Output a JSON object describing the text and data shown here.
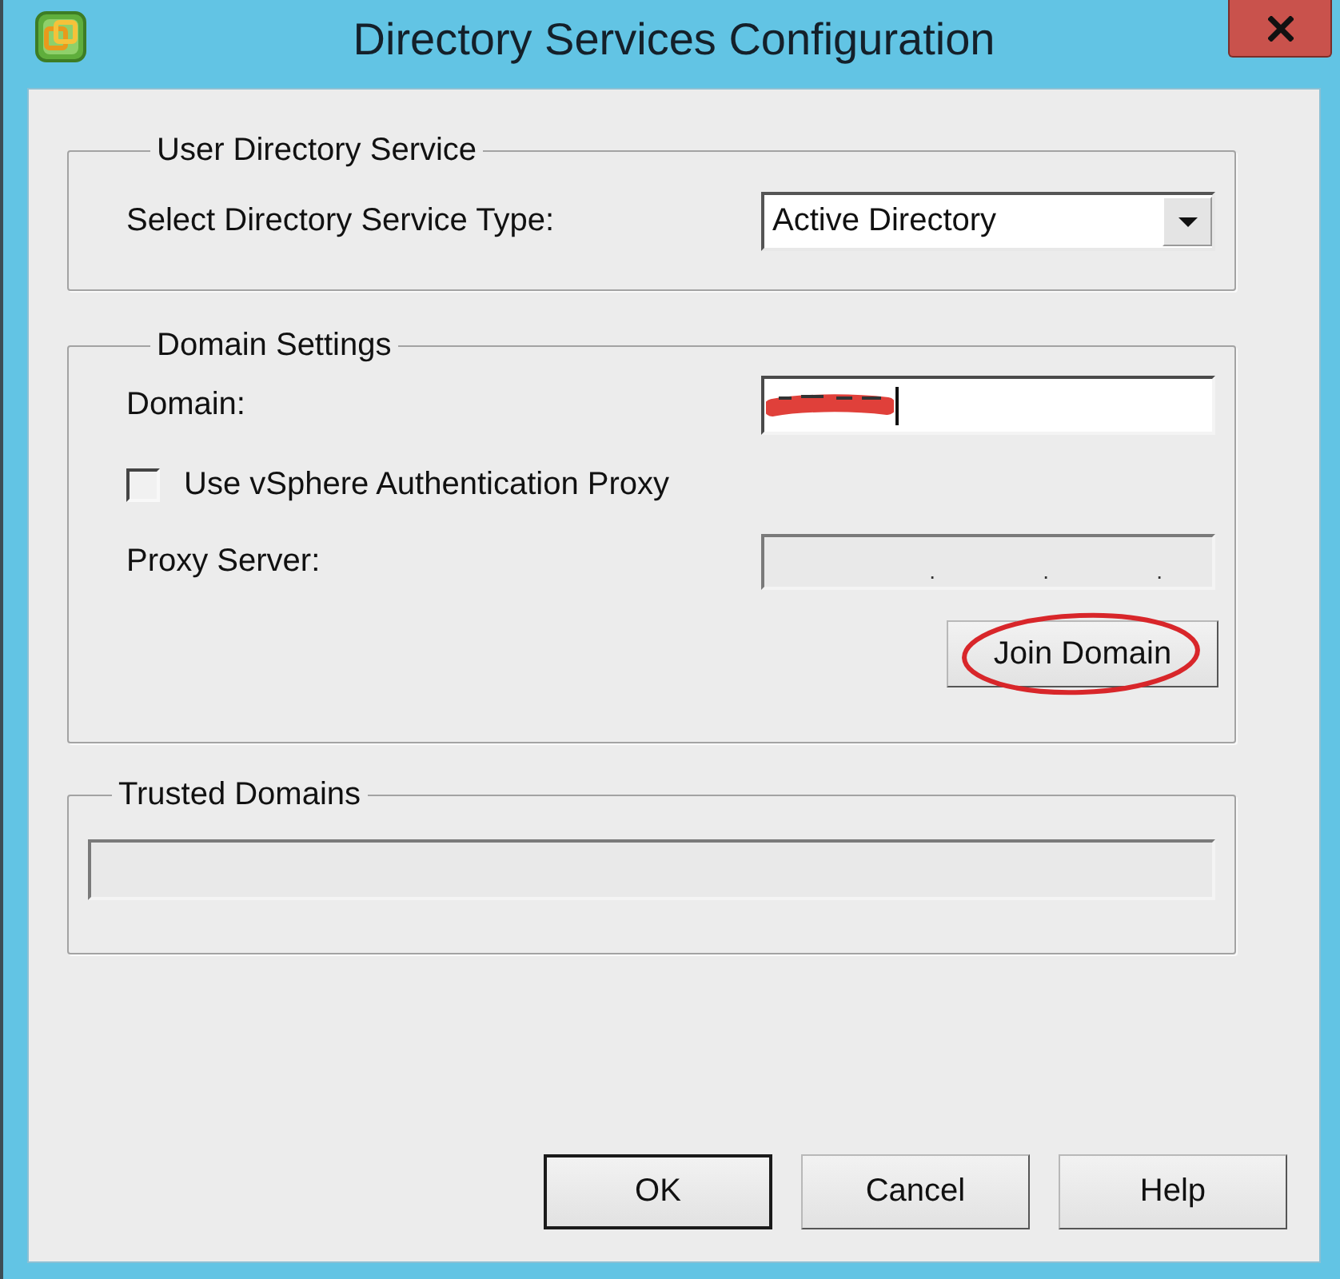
{
  "window": {
    "title": "Directory Services Configuration"
  },
  "user_directory_service": {
    "legend": "User Directory Service",
    "service_type": {
      "label": "Select Directory Service Type:",
      "value": "Active Directory"
    }
  },
  "domain_settings": {
    "legend": "Domain Settings",
    "domain": {
      "label": "Domain:",
      "redacted": true,
      "focused": true
    },
    "use_proxy": {
      "label": "Use vSphere Authentication Proxy",
      "checked": false
    },
    "proxy_server": {
      "label": "Proxy Server:",
      "disabled": true,
      "separators": [
        ".",
        ".",
        "."
      ]
    },
    "join_button": {
      "label": "Join Domain",
      "circled": true
    }
  },
  "trusted_domains": {
    "legend": "Trusted Domains",
    "list": {
      "disabled": true
    }
  },
  "buttons": [
    {
      "label": "OK",
      "default": true
    },
    {
      "label": "Cancel",
      "default": false
    },
    {
      "label": "Help",
      "default": false
    }
  ]
}
